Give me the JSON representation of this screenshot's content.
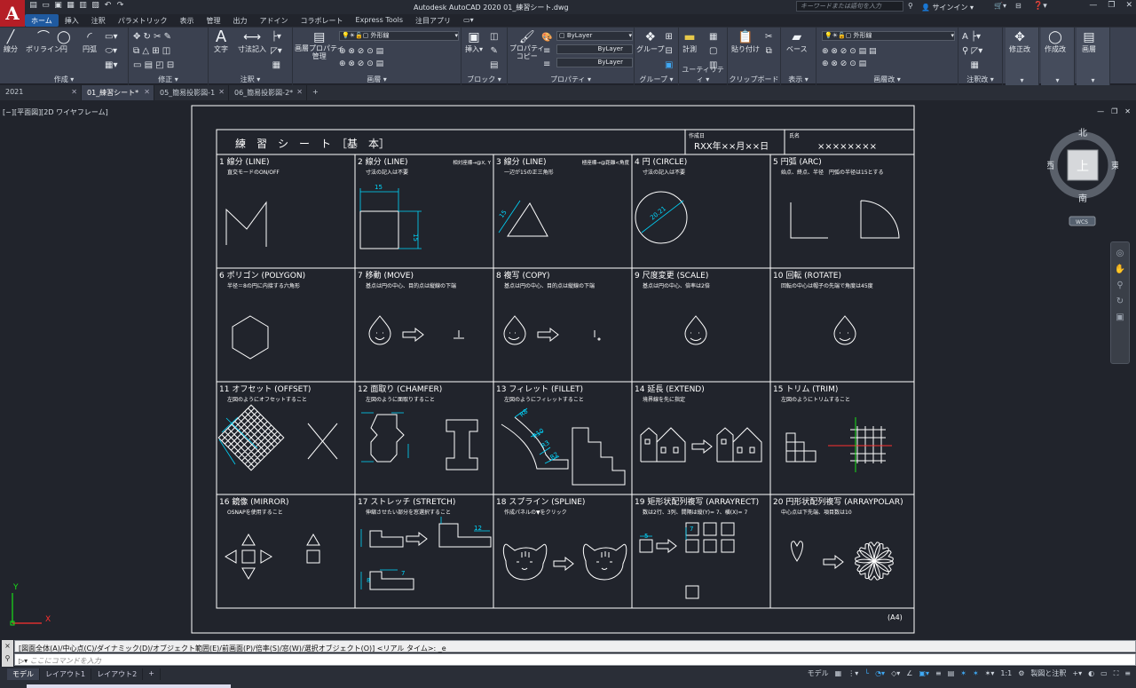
{
  "app": {
    "logo": "A",
    "title": "Autodesk AutoCAD 2020   01_練習シート.dwg",
    "search_placeholder": "キーワードまたは語句を入力",
    "signin": "サインイン",
    "qa_icons": [
      "new-icon",
      "open-icon",
      "save-icon",
      "saveas-icon",
      "print-icon",
      "plot-icon",
      "undo-icon",
      "redo-icon"
    ],
    "window_controls": [
      "—",
      "❐",
      "✕"
    ]
  },
  "menu": [
    "ホーム",
    "挿入",
    "注釈",
    "パラメトリック",
    "表示",
    "管理",
    "出力",
    "アドイン",
    "コラボレート",
    "Express Tools",
    "注目アプリ",
    "▭▾"
  ],
  "ribbon": {
    "draw": {
      "label": "作成 ▾",
      "tools": [
        "線分",
        "ポリライン",
        "円",
        "円弧"
      ]
    },
    "modify": {
      "label": "修正 ▾"
    },
    "annotation": {
      "label": "注釈 ▾",
      "tools": [
        "文字",
        "寸法記入"
      ]
    },
    "layers": {
      "label": "画層 ▾",
      "props": "画層プロパティ\n管理",
      "current": "外形線"
    },
    "block": {
      "label": "ブロック ▾",
      "insert": "挿入"
    },
    "properties": {
      "label": "プロパティ ▾",
      "copy": "プロパティ\nコピー",
      "color": "ByLayer",
      "linetype": "ByLayer",
      "lineweight": "ByLayer"
    },
    "groups": {
      "label": "グループ ▾",
      "tool": "グループ"
    },
    "utilities": {
      "label": "ユーティリティ ▾",
      "measure": "計測"
    },
    "clipboard": {
      "label": "クリップボード",
      "paste": "貼り付け"
    },
    "view": {
      "label": "表示 ▾",
      "base": "ベース"
    },
    "layer_modify": {
      "label": "画層改 ▾",
      "current": "外形線"
    },
    "annotation2": {
      "label": "注釈改 ▾",
      "text": "A"
    },
    "modify2": {
      "label": "修正改"
    },
    "create2": {
      "label": "作成改"
    },
    "layer2": {
      "label": "画層"
    }
  },
  "tabs": [
    {
      "label": "2021",
      "active": false
    },
    {
      "label": "01_練習シート*",
      "active": true
    },
    {
      "label": "05_簡易投影図-1",
      "active": false
    },
    {
      "label": "06_簡易投影図-2*",
      "active": false
    }
  ],
  "viewport": {
    "label": "[−][平面図][2D ワイヤフレーム]"
  },
  "viewcube": {
    "north": "北",
    "south": "南",
    "east": "東",
    "west": "西",
    "top": "上",
    "wcs": "WCS"
  },
  "sheet": {
    "title": "練　習　シ　ー　ト　［基　本］",
    "date_label": "作成日",
    "date_value": "RXX年××月××日",
    "name_label": "氏名",
    "name_value": "××××××××",
    "paper": "(A4)",
    "cells": [
      {
        "title": "1 線分 (LINE)",
        "note": "直交モードのON/OFF",
        "extra": ""
      },
      {
        "title": "2 線分 (LINE)",
        "note": "寸法の記入は不要",
        "extra": "相対座標→@X, Y"
      },
      {
        "title": "3 線分 (LINE)",
        "note": "一辺が15の正三角形",
        "extra": "極座標→@距離<角度"
      },
      {
        "title": "4 円 (CIRCLE)",
        "note": "寸法の記入は不要",
        "extra": ""
      },
      {
        "title": "5 円弧 (ARC)",
        "note": "始点、終点、半径　円弧の半径は15とする",
        "extra": ""
      },
      {
        "title": "6 ポリゴン (POLYGON)",
        "note": "半径＝8の円に内接する六角形",
        "extra": ""
      },
      {
        "title": "7 移動 (MOVE)",
        "note": "基点は円の中心、目的点は縦線の下端",
        "extra": ""
      },
      {
        "title": "8 複写 (COPY)",
        "note": "基点は円の中心、目的点は縦線の下端",
        "extra": ""
      },
      {
        "title": "9 尺度変更 (SCALE)",
        "note": "基点は円の中心、倍率は2倍",
        "extra": ""
      },
      {
        "title": "10 回転 (ROTATE)",
        "note": "回転の中心は帽子の先端で角度は45度",
        "extra": ""
      },
      {
        "title": "11 オフセット (OFFSET)",
        "note": "左図のようにオフセットすること",
        "extra": ""
      },
      {
        "title": "12 面取り (CHAMFER)",
        "note": "左図のように面取りすること",
        "extra": ""
      },
      {
        "title": "13 フィレット (FILLET)",
        "note": "左図のようにフィレットすること",
        "extra": ""
      },
      {
        "title": "14 延長 (EXTEND)",
        "note": "境界線を先に指定",
        "extra": ""
      },
      {
        "title": "15 トリム (TRIM)",
        "note": "左図のようにトリムすること",
        "extra": ""
      },
      {
        "title": "16 鏡像 (MIRROR)",
        "note": "OSNAPを使用すること",
        "extra": ""
      },
      {
        "title": "17 ストレッチ (STRETCH)",
        "note": "伸縮させたい部分を窓選択すること",
        "extra": ""
      },
      {
        "title": "18 スプライン (SPLINE)",
        "note": "作成パネルの▼をクリック",
        "extra": ""
      },
      {
        "title": "19 矩形状配列複写 (ARRAYRECT)",
        "note": "数は2行、3列、間隔は縦(Y)= 7、横(X)= 7",
        "extra": ""
      },
      {
        "title": "20 円形状配列複写 (ARRAYPOLAR)",
        "note": "中心点は下先端、項目数は10",
        "extra": ""
      }
    ],
    "dims": {
      "d15a": "15",
      "d15b": "15",
      "d15c": "15",
      "d2021": "20.21",
      "r8": "R8",
      "r10": "R10",
      "r3": "R3",
      "r2": "R2",
      "c7": "7",
      "c12": "12",
      "c8": "8",
      "c5": "5"
    }
  },
  "ucs": {
    "y": "Y",
    "x": "X"
  },
  "command": {
    "history": "[図面全体(A)/中心点(C)/ダイナミック(D)/オブジェクト範囲(E)/前画面(P)/倍率(S)/窓(W)/選択オブジェクト(O)] <リアル タイム>: _e",
    "placeholder": "ここにコマンドを入力",
    "left": "×"
  },
  "status": {
    "tabs": [
      "モデル",
      "レイアウト1",
      "レイアウト2",
      "+"
    ],
    "model": "モデル",
    "scale": "1:1",
    "annot": "製図と注釈"
  },
  "colors": {
    "cad_bg": "#21242c",
    "line": "#ffffff",
    "dim": "#00d8ff",
    "red": "#ff3030",
    "green": "#19e019",
    "accent": "#3fa9f5"
  }
}
